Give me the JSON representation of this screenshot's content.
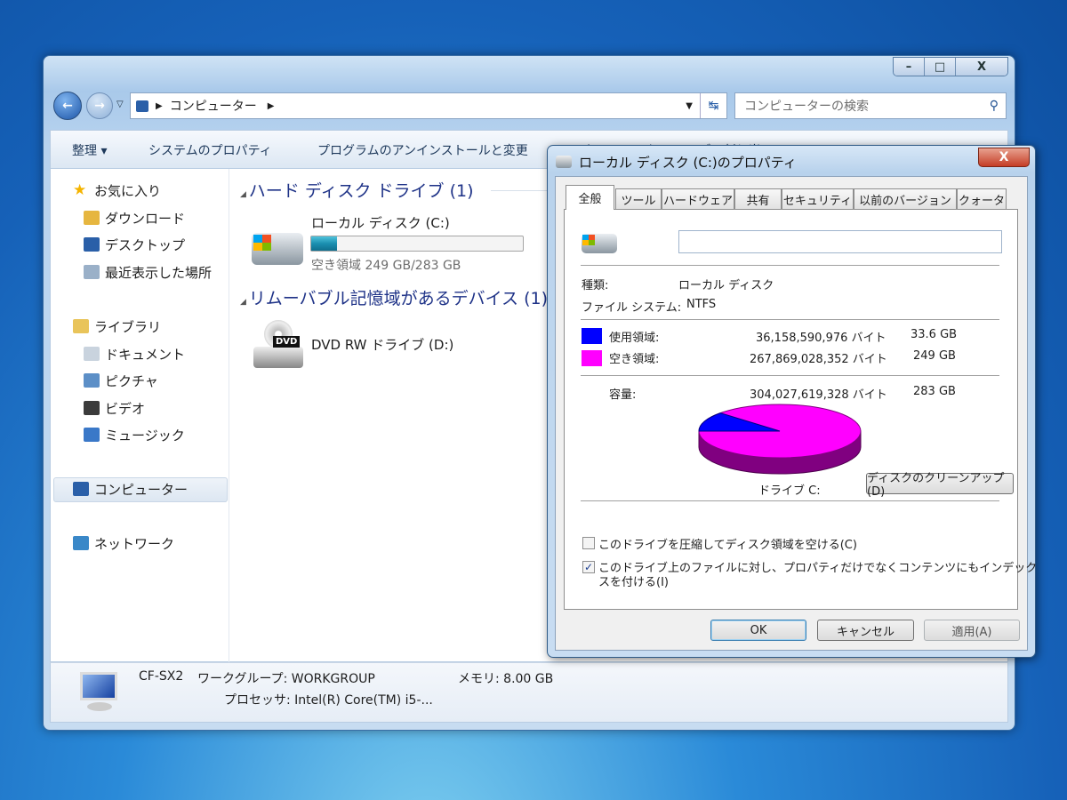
{
  "explorer": {
    "caption_buttons": {
      "minimize": "–",
      "maximize": "□",
      "close": "X"
    },
    "address": {
      "crumb": "コンピューター"
    },
    "search": {
      "placeholder": "コンピューターの検索"
    },
    "toolbar": {
      "organize": "整理 ▾",
      "system_properties": "システムのプロパティ",
      "uninstall": "プログラムのアンインストールと変更",
      "map_drive": "ネットワーク ドライブの割り当て"
    },
    "sidebar": {
      "items": [
        {
          "label": "お気に入り",
          "icon": "star-icon",
          "color": "#f5b400"
        },
        {
          "label": "ダウンロード",
          "icon": "download-folder-icon",
          "color": "#e6b640"
        },
        {
          "label": "デスクトップ",
          "icon": "desktop-icon",
          "color": "#2a5fa8"
        },
        {
          "label": "最近表示した場所",
          "icon": "recent-places-icon",
          "color": "#9ab0c8"
        },
        {
          "label": "ライブラリ",
          "icon": "library-icon",
          "color": "#e9c45a"
        },
        {
          "label": "ドキュメント",
          "icon": "documents-icon",
          "color": "#c9d3de"
        },
        {
          "label": "ピクチャ",
          "icon": "pictures-icon",
          "color": "#5c8fc7"
        },
        {
          "label": "ビデオ",
          "icon": "videos-icon",
          "color": "#3b3b3b"
        },
        {
          "label": "ミュージック",
          "icon": "music-icon",
          "color": "#3a78c8"
        },
        {
          "label": "コンピューター",
          "icon": "computer-icon",
          "color": "#2a5fa8"
        },
        {
          "label": "ネットワーク",
          "icon": "network-icon",
          "color": "#3a88c8"
        }
      ]
    },
    "sections": {
      "hdd": "ハード ディスク ドライブ (1)",
      "removable": "リムーバブル記憶域があるデバイス (1)"
    },
    "drives": {
      "c_label": "ローカル ディスク (C:)",
      "c_free": "空き領域 249 GB/283 GB",
      "c_used_percent": 12,
      "d_label": "DVD RW ドライブ (D:)",
      "dvd_badge": "DVD"
    },
    "details": {
      "name": "CF-SX2",
      "workgroup": "ワークグループ: WORKGROUP",
      "memory": "メモリ: 8.00 GB",
      "processor": "プロセッサ: Intel(R) Core(TM) i5-..."
    }
  },
  "dialog": {
    "title": "ローカル ディスク (C:)のプロパティ",
    "close": "X",
    "tabs": [
      "全般",
      "ツール",
      "ハードウェア",
      "共有",
      "セキュリティ",
      "以前のバージョン",
      "クォータ"
    ],
    "name_value": "",
    "type_label": "種類:",
    "type_value": "ローカル ディスク",
    "fs_label": "ファイル システム:",
    "fs_value": "NTFS",
    "used": {
      "label": "使用領域:",
      "bytes": "36,158,590,976 バイト",
      "size": "33.6 GB",
      "color": "#0000ff"
    },
    "free": {
      "label": "空き領域:",
      "bytes": "267,869,028,352 バイト",
      "size": "249 GB",
      "color": "#ff00ff"
    },
    "capacity": {
      "label": "容量:",
      "bytes": "304,027,619,328 バイト",
      "size": "283 GB"
    },
    "drive_caption": "ドライブ C:",
    "cleanup": "ディスクのクリーンアップ(D)",
    "compress": {
      "label": "このドライブを圧縮してディスク領域を空ける(C)",
      "checked": false
    },
    "index": {
      "label1": "このドライブ上のファイルに対し、プロパティだけでなくコンテンツにもインデック",
      "label2": "スを付ける(I)",
      "checked": true
    },
    "buttons": {
      "ok": "OK",
      "cancel": "キャンセル",
      "apply": "適用(A)"
    }
  },
  "chart_data": {
    "type": "pie",
    "categories": [
      "使用領域",
      "空き領域"
    ],
    "values": [
      36158590976,
      267869028352
    ],
    "colors": [
      "#0000ff",
      "#ff00ff"
    ],
    "title": "ドライブ C:"
  }
}
